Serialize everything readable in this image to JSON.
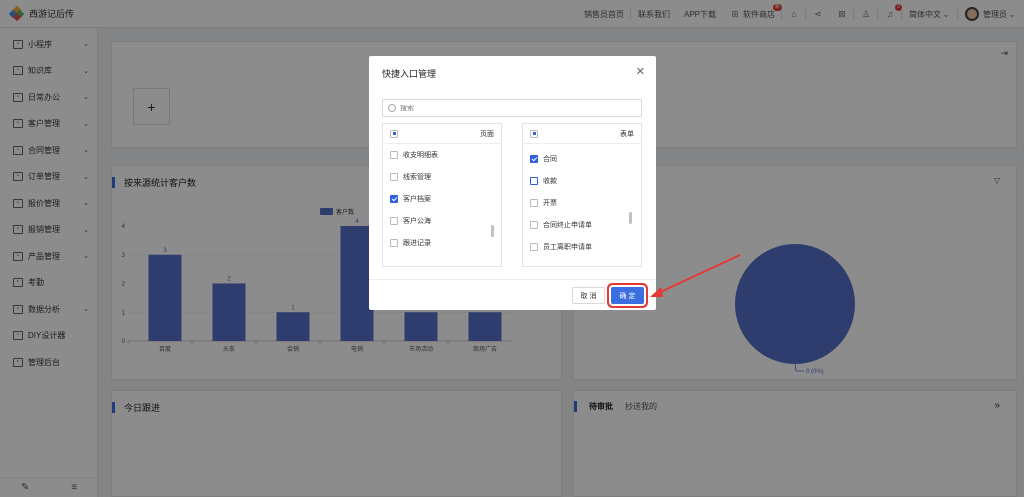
{
  "app": {
    "title": "西游记后传"
  },
  "topnav": {
    "items": [
      "销售员首页",
      "联系我们",
      "APP下载",
      "软件商店"
    ],
    "store_badge": "新",
    "notify_badge": "0",
    "language": "简体中文",
    "user": "管理员"
  },
  "sidebar": {
    "items": [
      {
        "label": "小程序",
        "icon": "mini-program-icon"
      },
      {
        "label": "知识库",
        "icon": "book-icon"
      },
      {
        "label": "日常办公",
        "icon": "office-icon"
      },
      {
        "label": "客户管理",
        "icon": "customer-icon"
      },
      {
        "label": "合同管理",
        "icon": "contract-icon"
      },
      {
        "label": "订单管理",
        "icon": "order-icon"
      },
      {
        "label": "报价管理",
        "icon": "quote-icon"
      },
      {
        "label": "报销管理",
        "icon": "reimburse-icon"
      },
      {
        "label": "产品管理",
        "icon": "product-icon"
      },
      {
        "label": "考勤",
        "icon": "attendance-icon"
      },
      {
        "label": "数据分析",
        "icon": "analytics-icon"
      },
      {
        "label": "DIY设计器",
        "icon": "designer-icon"
      },
      {
        "label": "管理后台",
        "icon": "admin-icon"
      }
    ]
  },
  "dashboard": {
    "add_label": "+",
    "chart1_title": "按来源统计客户数",
    "chart2_label": "0 (0%)",
    "today_title": "今日跟进",
    "tab_pending": "待审批",
    "tab_cc": "抄送我的"
  },
  "chart_data": {
    "type": "bar",
    "title": "按来源统计客户数",
    "legend": [
      "客户数"
    ],
    "categories": [
      "百度",
      "头条",
      "会销",
      "电销",
      "市场活动",
      "商场广告"
    ],
    "series": [
      {
        "name": "客户数",
        "values": [
          3,
          2,
          1,
          4,
          1,
          1
        ]
      }
    ],
    "yticks": [
      0,
      1,
      2,
      3,
      4
    ],
    "ylim": [
      0,
      4
    ],
    "color": "#5470c6"
  },
  "modal": {
    "title": "快捷入口管理",
    "search_placeholder": "搜索",
    "left_header": "页面",
    "right_header": "表单",
    "left_items": [
      {
        "label": "收支明细表",
        "checked": false
      },
      {
        "label": "线索管理",
        "checked": false
      },
      {
        "label": "客户档案",
        "checked": true
      },
      {
        "label": "客户公海",
        "checked": false
      },
      {
        "label": "跟进记录",
        "checked": false
      }
    ],
    "right_items": [
      {
        "label": "合同",
        "checked": true
      },
      {
        "label": "收款",
        "checked": false
      },
      {
        "label": "开票",
        "checked": false
      },
      {
        "label": "合同终止申请单",
        "checked": false
      },
      {
        "label": "员工离职申请单",
        "checked": false
      }
    ],
    "cancel_label": "取 消",
    "ok_label": "确 定"
  },
  "colors": {
    "accent": "#3b6ee0",
    "highlight": "#e53935"
  }
}
